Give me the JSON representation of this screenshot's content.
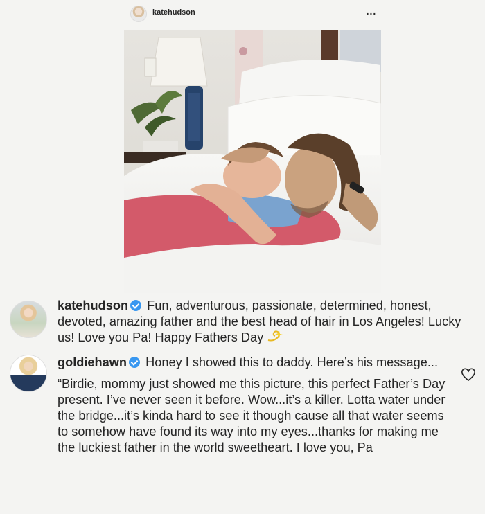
{
  "header": {
    "username": "katehudson",
    "more_label": "..."
  },
  "photo": {
    "icon": "family-photo"
  },
  "comments": [
    {
      "username": "katehudson",
      "verified": true,
      "text": "Fun, adventurous, passionate, determined, honest, devoted, amazing father and the best head of hair in Los Angeles! Lucky us! Love you Pa! Happy Fathers Day",
      "emoji": "dizzy-icon"
    },
    {
      "username": "goldiehawn",
      "verified": true,
      "text": "Honey I showed this to daddy. Here’s his message...",
      "quote": "“Birdie, mommy just showed me this picture, this perfect Father’s Day present. I’ve never seen it before. Wow...it’s a killer. Lotta water under the bridge...it’s kinda hard to see it though cause all that water seems to somehow have found its way into my eyes...thanks for making me the luckiest father in the world sweetheart. I love you, Pa",
      "like_icon": "heart-icon"
    }
  ],
  "colors": {
    "background": "#f4f4f2",
    "text": "#262626",
    "verified": "#3897f0"
  }
}
